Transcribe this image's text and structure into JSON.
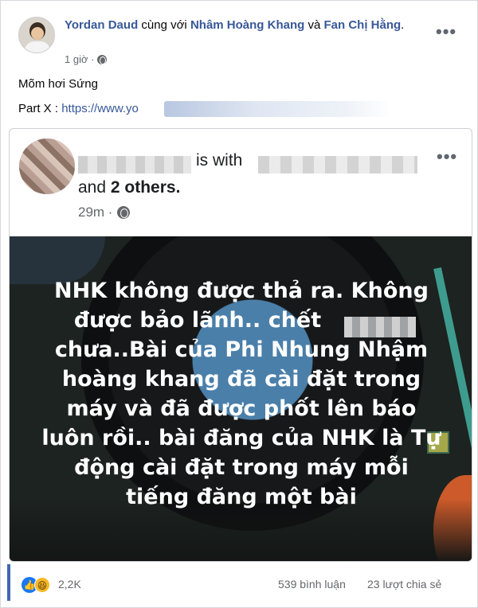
{
  "outer_post": {
    "author": "Yordan Daud",
    "with_text": "cùng với",
    "tagged_1": "Nhâm Hoàng Khang",
    "and_text": "và",
    "tagged_2": "Fan Chị Hằng",
    "time": "1 giờ ·",
    "caption_line_1": "Mõm hơi Sứng",
    "caption_line_2_prefix": "Part X : ",
    "caption_link": "https://www.yo",
    "more_icon": "more-horizontal-dots",
    "privacy_icon": "globe-icon"
  },
  "inner_post": {
    "with_text": "is with",
    "and_others_prefix": "and",
    "others": "2 others.",
    "time": "29m ·",
    "more_icon": "more-horizontal-dots",
    "privacy_icon": "globe-icon",
    "image_text": [
      "NHK không được thả ra. Không",
      "được bảo lãnh.. chết",
      "chưa..Bài của Phi Nhung Nhậm",
      "hoàng khang đã cài đặt trong",
      "máy và đã được phốt lên báo",
      "luôn rồi.. bài đăng của NHK là Tự",
      "động cài đặt trong máy mỗi",
      "tiếng đăng một bài"
    ]
  },
  "footer": {
    "reaction_icons": [
      "like-icon",
      "haha-icon"
    ],
    "reaction_count": "2,2K",
    "comments": "539 bình luận",
    "shares": "23 lượt chia sẻ"
  },
  "colors": {
    "link_blue": "#385898",
    "meta_gray": "#65676b",
    "image_bg": "#1d2320",
    "vinyl_label": "#4a7faa",
    "like_blue": "#1877f2",
    "haha_yellow": "#f7b928"
  }
}
